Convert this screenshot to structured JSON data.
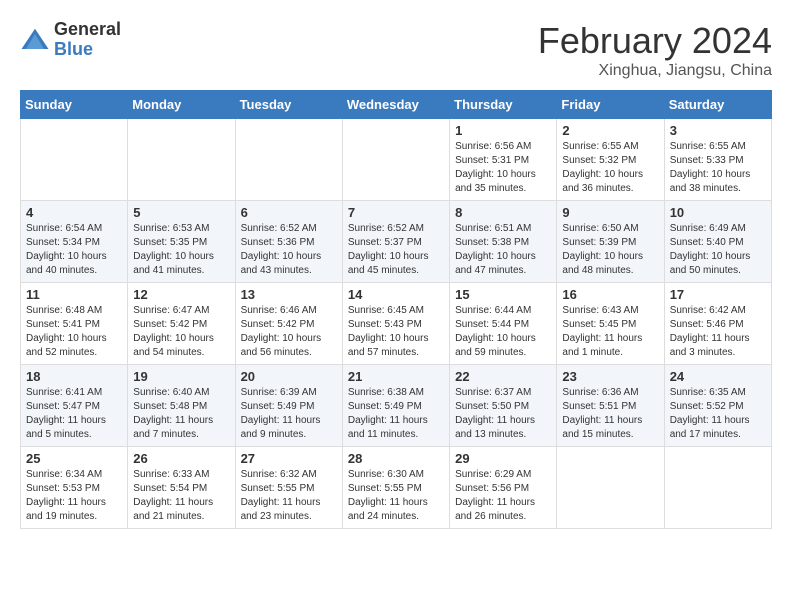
{
  "header": {
    "logo_general": "General",
    "logo_blue": "Blue",
    "title": "February 2024",
    "location": "Xinghua, Jiangsu, China"
  },
  "weekdays": [
    "Sunday",
    "Monday",
    "Tuesday",
    "Wednesday",
    "Thursday",
    "Friday",
    "Saturday"
  ],
  "weeks": [
    [
      {
        "day": "",
        "info": ""
      },
      {
        "day": "",
        "info": ""
      },
      {
        "day": "",
        "info": ""
      },
      {
        "day": "",
        "info": ""
      },
      {
        "day": "1",
        "info": "Sunrise: 6:56 AM\nSunset: 5:31 PM\nDaylight: 10 hours\nand 35 minutes."
      },
      {
        "day": "2",
        "info": "Sunrise: 6:55 AM\nSunset: 5:32 PM\nDaylight: 10 hours\nand 36 minutes."
      },
      {
        "day": "3",
        "info": "Sunrise: 6:55 AM\nSunset: 5:33 PM\nDaylight: 10 hours\nand 38 minutes."
      }
    ],
    [
      {
        "day": "4",
        "info": "Sunrise: 6:54 AM\nSunset: 5:34 PM\nDaylight: 10 hours\nand 40 minutes."
      },
      {
        "day": "5",
        "info": "Sunrise: 6:53 AM\nSunset: 5:35 PM\nDaylight: 10 hours\nand 41 minutes."
      },
      {
        "day": "6",
        "info": "Sunrise: 6:52 AM\nSunset: 5:36 PM\nDaylight: 10 hours\nand 43 minutes."
      },
      {
        "day": "7",
        "info": "Sunrise: 6:52 AM\nSunset: 5:37 PM\nDaylight: 10 hours\nand 45 minutes."
      },
      {
        "day": "8",
        "info": "Sunrise: 6:51 AM\nSunset: 5:38 PM\nDaylight: 10 hours\nand 47 minutes."
      },
      {
        "day": "9",
        "info": "Sunrise: 6:50 AM\nSunset: 5:39 PM\nDaylight: 10 hours\nand 48 minutes."
      },
      {
        "day": "10",
        "info": "Sunrise: 6:49 AM\nSunset: 5:40 PM\nDaylight: 10 hours\nand 50 minutes."
      }
    ],
    [
      {
        "day": "11",
        "info": "Sunrise: 6:48 AM\nSunset: 5:41 PM\nDaylight: 10 hours\nand 52 minutes."
      },
      {
        "day": "12",
        "info": "Sunrise: 6:47 AM\nSunset: 5:42 PM\nDaylight: 10 hours\nand 54 minutes."
      },
      {
        "day": "13",
        "info": "Sunrise: 6:46 AM\nSunset: 5:42 PM\nDaylight: 10 hours\nand 56 minutes."
      },
      {
        "day": "14",
        "info": "Sunrise: 6:45 AM\nSunset: 5:43 PM\nDaylight: 10 hours\nand 57 minutes."
      },
      {
        "day": "15",
        "info": "Sunrise: 6:44 AM\nSunset: 5:44 PM\nDaylight: 10 hours\nand 59 minutes."
      },
      {
        "day": "16",
        "info": "Sunrise: 6:43 AM\nSunset: 5:45 PM\nDaylight: 11 hours\nand 1 minute."
      },
      {
        "day": "17",
        "info": "Sunrise: 6:42 AM\nSunset: 5:46 PM\nDaylight: 11 hours\nand 3 minutes."
      }
    ],
    [
      {
        "day": "18",
        "info": "Sunrise: 6:41 AM\nSunset: 5:47 PM\nDaylight: 11 hours\nand 5 minutes."
      },
      {
        "day": "19",
        "info": "Sunrise: 6:40 AM\nSunset: 5:48 PM\nDaylight: 11 hours\nand 7 minutes."
      },
      {
        "day": "20",
        "info": "Sunrise: 6:39 AM\nSunset: 5:49 PM\nDaylight: 11 hours\nand 9 minutes."
      },
      {
        "day": "21",
        "info": "Sunrise: 6:38 AM\nSunset: 5:49 PM\nDaylight: 11 hours\nand 11 minutes."
      },
      {
        "day": "22",
        "info": "Sunrise: 6:37 AM\nSunset: 5:50 PM\nDaylight: 11 hours\nand 13 minutes."
      },
      {
        "day": "23",
        "info": "Sunrise: 6:36 AM\nSunset: 5:51 PM\nDaylight: 11 hours\nand 15 minutes."
      },
      {
        "day": "24",
        "info": "Sunrise: 6:35 AM\nSunset: 5:52 PM\nDaylight: 11 hours\nand 17 minutes."
      }
    ],
    [
      {
        "day": "25",
        "info": "Sunrise: 6:34 AM\nSunset: 5:53 PM\nDaylight: 11 hours\nand 19 minutes."
      },
      {
        "day": "26",
        "info": "Sunrise: 6:33 AM\nSunset: 5:54 PM\nDaylight: 11 hours\nand 21 minutes."
      },
      {
        "day": "27",
        "info": "Sunrise: 6:32 AM\nSunset: 5:55 PM\nDaylight: 11 hours\nand 23 minutes."
      },
      {
        "day": "28",
        "info": "Sunrise: 6:30 AM\nSunset: 5:55 PM\nDaylight: 11 hours\nand 24 minutes."
      },
      {
        "day": "29",
        "info": "Sunrise: 6:29 AM\nSunset: 5:56 PM\nDaylight: 11 hours\nand 26 minutes."
      },
      {
        "day": "",
        "info": ""
      },
      {
        "day": "",
        "info": ""
      }
    ]
  ]
}
